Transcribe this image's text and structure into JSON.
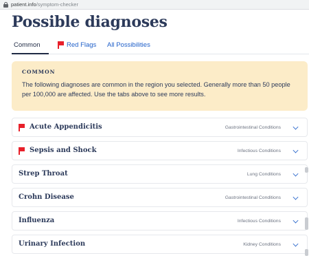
{
  "browser": {
    "url_domain": "patient.info",
    "url_path": "/symptom-checker"
  },
  "page": {
    "title": "Possible diagnoses"
  },
  "tabs": [
    {
      "label": "Common",
      "active": true,
      "flag": false
    },
    {
      "label": "Red Flags",
      "active": false,
      "flag": true
    },
    {
      "label": "All Possibilities",
      "active": false,
      "flag": false
    }
  ],
  "info_box": {
    "heading": "COMMON",
    "text": "The following diagnoses are common in the region you selected. Generally more than 50 people per 100,000 are affected. Use the tabs above to see more results."
  },
  "diagnoses": [
    {
      "name": "Acute Appendicitis",
      "category": "Gastrointestinal Conditions",
      "red_flag": true
    },
    {
      "name": "Sepsis and Shock",
      "category": "Infectious Conditions",
      "red_flag": true
    },
    {
      "name": "Strep Throat",
      "category": "Lung Conditions",
      "red_flag": false
    },
    {
      "name": "Crohn Disease",
      "category": "Gastrointestinal Conditions",
      "red_flag": false
    },
    {
      "name": "Influenza",
      "category": "Infectious Conditions",
      "red_flag": false
    },
    {
      "name": "Urinary Infection",
      "category": "Kidney Conditions",
      "red_flag": false
    }
  ],
  "colors": {
    "link_blue": "#1f5fc9",
    "red_flag": "#e8202a",
    "info_bg": "#fcecc8",
    "heading_navy": "#2c3a5a"
  },
  "icons": {
    "lock": "lock-icon",
    "flag": "red-flag-icon",
    "chevron": "chevron-down-icon"
  }
}
